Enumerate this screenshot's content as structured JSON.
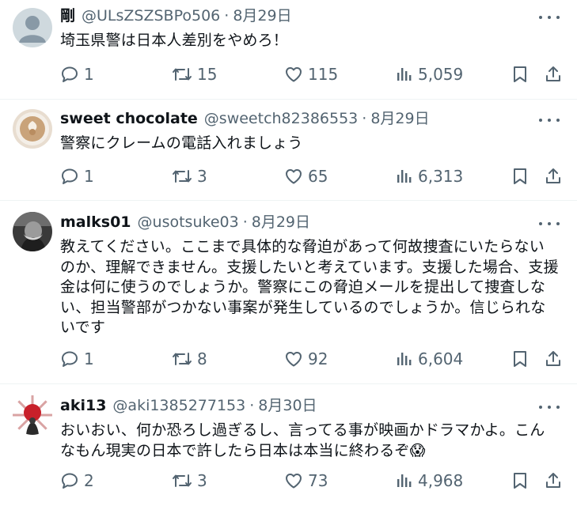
{
  "tweets": [
    {
      "name": "剛",
      "handle": "@ULsZSZSBPo506",
      "separator": "·",
      "date": "8月29日",
      "text": "埼玉県警は日本人差別をやめろ！",
      "replies": "1",
      "retweets": "15",
      "likes": "115",
      "views": "5,059",
      "avatar_icon": "default-avatar-icon"
    },
    {
      "name": "sweet chocolate",
      "handle": "@sweetch82386553",
      "separator": "·",
      "date": "8月29日",
      "text": "警察にクレームの電話入れましょう",
      "replies": "1",
      "retweets": "3",
      "likes": "65",
      "views": "6,313",
      "avatar_icon": "latte-art-avatar"
    },
    {
      "name": "malks01",
      "handle": "@usotsuke03",
      "separator": "·",
      "date": "8月29日",
      "text": "教えてください。ここまで具体的な脅迫があって何故捜査にいたらないのか、理解できません。支援したいと考えています。支援した場合、支援金は何に使うのでしょうか。警察にこの脅迫メールを提出して捜査しない、担当警部がつかない事案が発生しているのでしょうか。信じられないです",
      "replies": "1",
      "retweets": "8",
      "likes": "92",
      "views": "6,604",
      "avatar_icon": "portrait-avatar"
    },
    {
      "name": "aki13",
      "handle": "@aki1385277153",
      "separator": "·",
      "date": "8月30日",
      "text": "おいおい、何か恐ろし過ぎるし、言ってる事が映画かドラマかよ。こんなもん現実の日本で許したら日本は本当に終わるぞ😱",
      "replies": "2",
      "retweets": "3",
      "likes": "73",
      "views": "4,968",
      "avatar_icon": "rising-sun-avatar"
    }
  ],
  "colors": {
    "text": "#0f1419",
    "secondary": "#536471",
    "divider": "#eff3f4"
  }
}
